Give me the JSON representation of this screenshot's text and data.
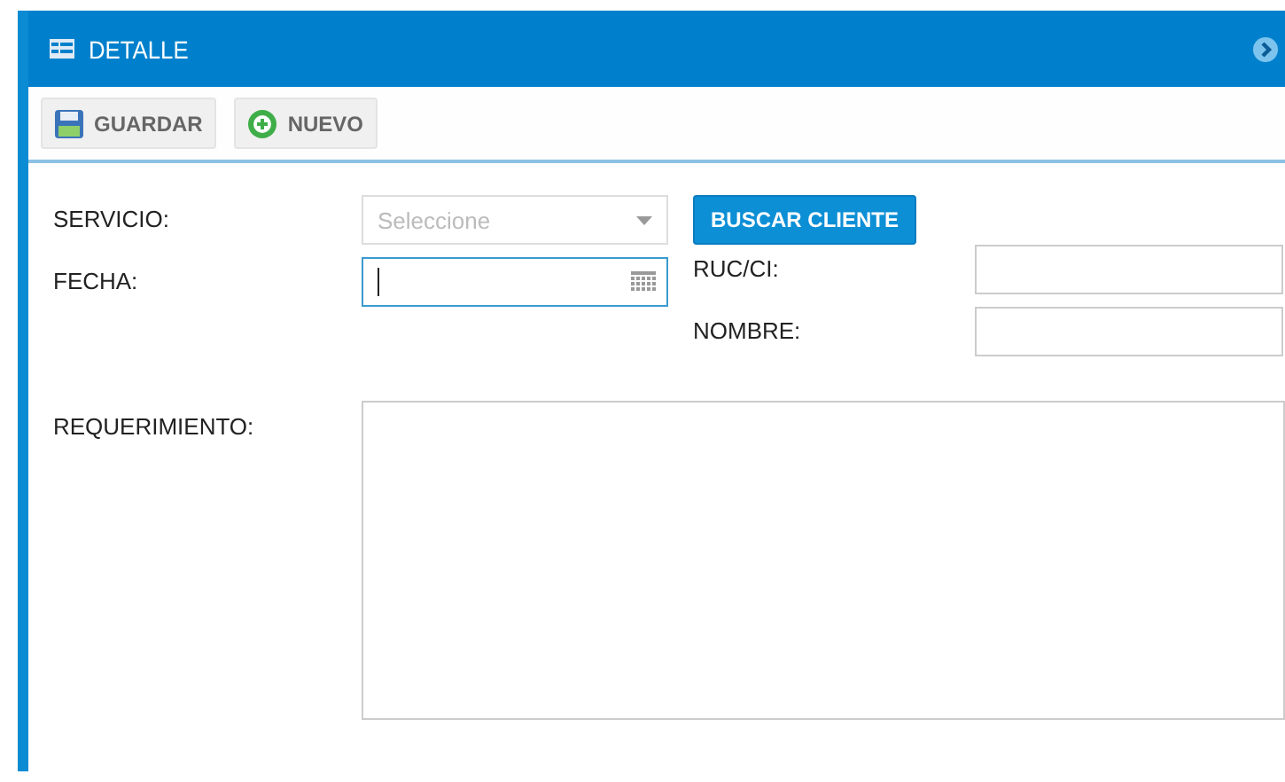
{
  "window": {
    "title": "DETALLE"
  },
  "toolbar": [
    {
      "kind": "save",
      "label": "GUARDAR"
    },
    {
      "kind": "new",
      "label": "NUEVO"
    }
  ],
  "form": {
    "servicio": {
      "label": "SERVICIO:",
      "placeholder": "Seleccione"
    },
    "fecha": {
      "label": "FECHA:",
      "focused": true
    },
    "buscar_button": "BUSCAR CLIENTE",
    "ruc": {
      "label": "RUC/CI:"
    },
    "nombre": {
      "label": "NOMBRE:"
    },
    "requerimiento": {
      "label": "REQUERIMIENTO:"
    }
  }
}
